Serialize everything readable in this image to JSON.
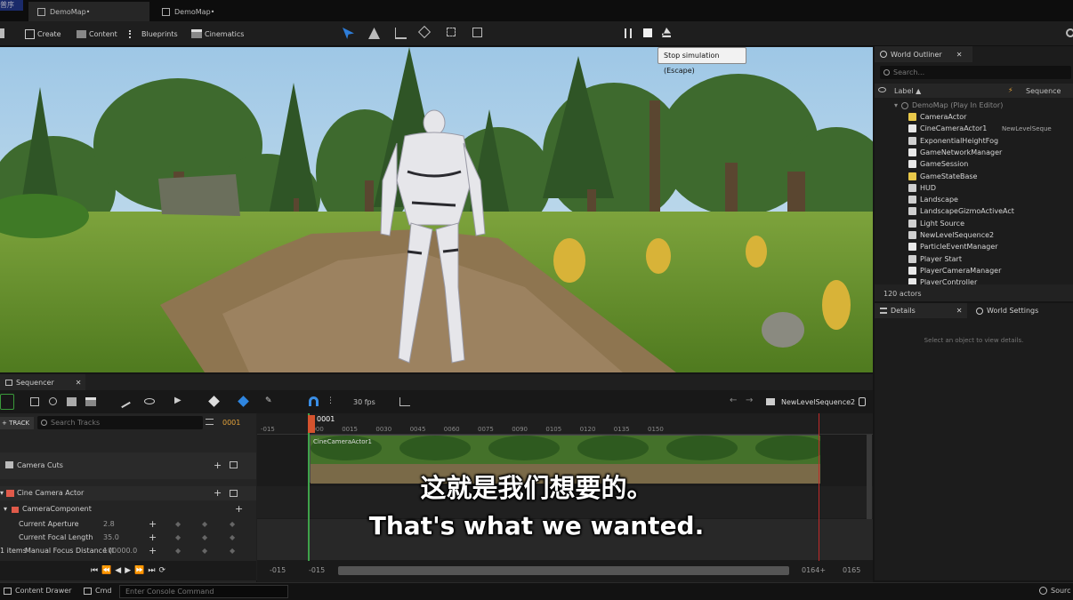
{
  "titlebar": {
    "logo_text": "普序",
    "tabs": [
      {
        "label": "DemoMap•"
      },
      {
        "label": "DemoMap•"
      }
    ]
  },
  "toolbar": {
    "create": "Create",
    "content": "Content",
    "blueprints": "Blueprints",
    "cinematics": "Cinematics"
  },
  "tooltip": "Stop simulation (Escape)",
  "outliner": {
    "tab": "World Outliner",
    "search_placeholder": "Search...",
    "col_label": "Label ▲",
    "col_sequence": "Sequence",
    "root": "DemoMap (Play In Editor)",
    "items": [
      {
        "label": "CameraActor",
        "icon_color": "#e8c84a"
      },
      {
        "label": "CineCameraActor1",
        "icon_color": "#e8e8e8",
        "extra": "NewLevelSeque"
      },
      {
        "label": "ExponentialHeightFog",
        "icon_color": "#cfcfcf"
      },
      {
        "label": "GameNetworkManager",
        "icon_color": "#e8e8e8"
      },
      {
        "label": "GameSession",
        "icon_color": "#e8e8e8"
      },
      {
        "label": "GameStateBase",
        "icon_color": "#e8c84a"
      },
      {
        "label": "HUD",
        "icon_color": "#cfcfcf"
      },
      {
        "label": "Landscape",
        "icon_color": "#cfcfcf"
      },
      {
        "label": "LandscapeGizmoActiveAct",
        "icon_color": "#cfcfcf"
      },
      {
        "label": "Light Source",
        "icon_color": "#cfcfcf"
      },
      {
        "label": "NewLevelSequence2",
        "icon_color": "#cfcfcf"
      },
      {
        "label": "ParticleEventManager",
        "icon_color": "#e8e8e8"
      },
      {
        "label": "Player Start",
        "icon_color": "#cfcfcf"
      },
      {
        "label": "PlayerCameraManager",
        "icon_color": "#e8e8e8"
      },
      {
        "label": "PlayerController",
        "icon_color": "#e8e8e8"
      }
    ],
    "count": "120 actors"
  },
  "details": {
    "tab": "Details",
    "tab2": "World Settings",
    "empty": "Select an object to view details."
  },
  "sequencer": {
    "tab": "Sequencer",
    "fps": "30 fps",
    "sequence_name": "NewLevelSequence2",
    "track_button": "TRACK",
    "search_placeholder": "Search Tracks",
    "current_frame": "0001",
    "playhead_label": "0001",
    "ticks": [
      "-015",
      "0000",
      "0015",
      "0030",
      "0045",
      "0060",
      "0075",
      "0090",
      "0105",
      "0120",
      "0135",
      "0150"
    ],
    "section_label": "CineCameraActor1",
    "tracks": {
      "camera_cuts": "Camera Cuts",
      "cine_camera": "Cine Camera Actor",
      "camera_component": "CameraComponent",
      "aperture_label": "Current Aperture",
      "aperture_value": "2.8",
      "focal_label": "Current Focal Length",
      "focal_value": "35.0",
      "focus_label": "Manual Focus Distance (I",
      "focus_value": "100000.0"
    },
    "items_count": "1 items",
    "range_left": "-015",
    "range_left2": "-015",
    "range_right": "0164+",
    "range_right2": "0165"
  },
  "statusbar": {
    "content_drawer": "Content Drawer",
    "cmd": "Cmd",
    "console_placeholder": "Enter Console Command",
    "source": "Sourc"
  },
  "subtitles": {
    "zh": "这就是我们想要的。",
    "en": "That's what we wanted."
  }
}
